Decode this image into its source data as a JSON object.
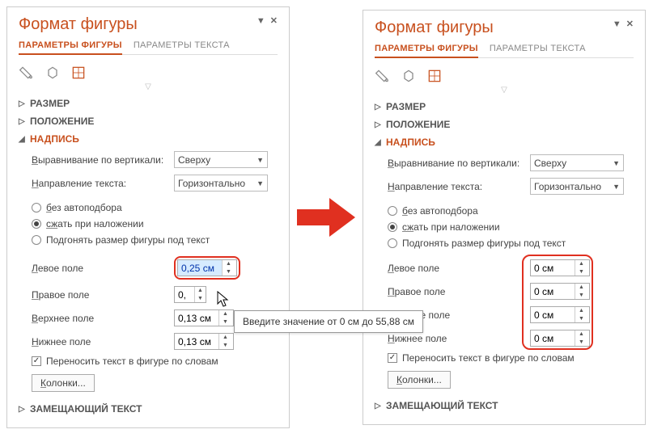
{
  "panel": {
    "title": "Формат фигуры",
    "tabs": {
      "params": "ПАРАМЕТРЫ ФИГУРЫ",
      "text": "ПАРАМЕТРЫ ТЕКСТА"
    },
    "sections": {
      "size": "РАЗМЕР",
      "position": "ПОЛОЖЕНИЕ",
      "textbox": "НАДПИСЬ",
      "alttext": "ЗАМЕЩАЮЩИЙ ТЕКСТ"
    },
    "labels": {
      "valign_pre": "В",
      "valign_rest": "ыравнивание по вертикали:",
      "dir_pre": "Н",
      "dir_rest": "аправление текста:",
      "autofit_none_pre": "б",
      "autofit_none_rest": "ез автоподбора",
      "autofit_shrink_pre": "сж",
      "autofit_shrink_rest": "ать при наложении",
      "autofit_resize": "Подгонять размер фигуры под текст",
      "left_pre": "Л",
      "left_rest": "евое поле",
      "right_pre": "П",
      "right_rest": "равое поле",
      "top_pre": "В",
      "top_rest": "ерхнее поле",
      "bottom_pre": "Н",
      "bottom_rest": "ижнее поле",
      "wrap": "Переносить текст в фигуре по словам",
      "columns_pre": "К",
      "columns_rest": "олонки..."
    },
    "selects": {
      "valign": "Сверху",
      "direction": "Горизонтально"
    },
    "left_values": {
      "left": "0,25 см",
      "right": "0,",
      "top": "0,13 см",
      "bottom": "0,13 см"
    },
    "right_values": {
      "left": "0 см",
      "right": "0 см",
      "top": "0 см",
      "bottom": "0 см"
    },
    "tooltip": "Введите значение от 0 см до 55,88 см"
  }
}
